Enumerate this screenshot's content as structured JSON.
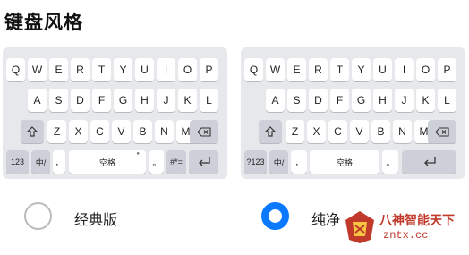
{
  "section": {
    "title": "键盘风格"
  },
  "keyboard": {
    "row1": [
      "Q",
      "W",
      "E",
      "R",
      "T",
      "Y",
      "U",
      "I",
      "O",
      "P"
    ],
    "row2": [
      "A",
      "S",
      "D",
      "F",
      "G",
      "H",
      "J",
      "K",
      "L"
    ],
    "row3": [
      "Z",
      "X",
      "C",
      "V",
      "B",
      "N",
      "M"
    ],
    "left_bottom": {
      "num": "123",
      "lang": "中/",
      "comma": "，",
      "space": "空格",
      "period": "。",
      "symbol": "#*="
    },
    "right_bottom": {
      "num": "?123",
      "lang": "中/",
      "comma": "，",
      "space": "空格",
      "period": "。"
    },
    "shift_icon": "shift-arrow-icon",
    "delete_icon": "backspace-icon",
    "enter_icon": "enter-icon"
  },
  "options": [
    {
      "label": "经典版",
      "selected": false
    },
    {
      "label": "纯净",
      "selected": true
    }
  ],
  "watermark": {
    "name": "八神智能天下",
    "url": "zntx.cc"
  },
  "colors": {
    "accent": "#0a78ff",
    "panel": "#e7e8ec",
    "func_key": "#cdd0d8"
  }
}
